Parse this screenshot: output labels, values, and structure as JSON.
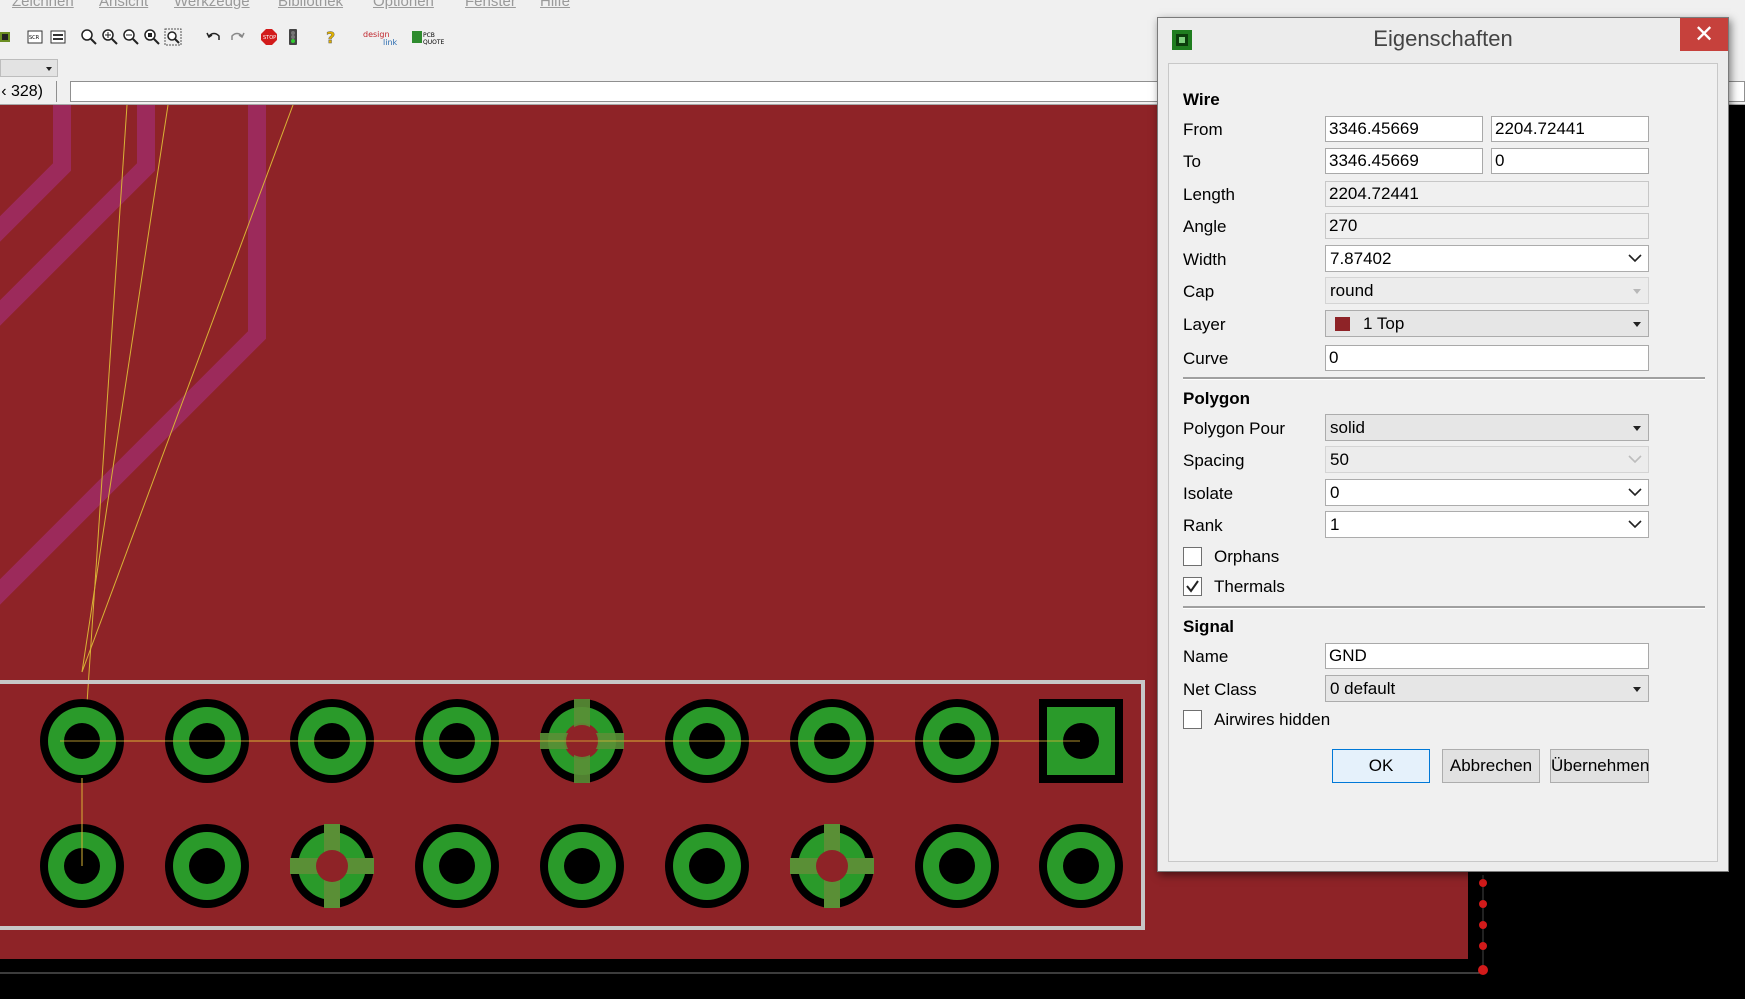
{
  "menubar": {
    "items": [
      "Zeichnen",
      "Ansicht",
      "Werkzeuge",
      "Bibliothek",
      "Optionen",
      "Fenster",
      "Hilfe"
    ]
  },
  "toolbar": {
    "icons": [
      "board-icon",
      "script-icon",
      "script2-icon",
      "zoom-fit-icon",
      "zoom-in-icon",
      "zoom-out-icon",
      "zoom-select-icon",
      "zoom-window-icon",
      "undo-icon",
      "redo-icon",
      "stop-icon",
      "go-icon",
      "help-icon",
      "design-link-icon",
      "pcb-quote-icon"
    ]
  },
  "command_line": {
    "coordinates": "328)",
    "coordinates_prefix": "‹",
    "value": ""
  },
  "colors": {
    "board_copper_top": "#8e2327",
    "pad_green": "#2a9a2a",
    "dimension_outline": "#c7c7c7",
    "airwire": "#d9b236",
    "dialog_close": "#c6413c",
    "layer_swatch": "#8e2327"
  },
  "dialog": {
    "title": "Eigenschaften",
    "close_glyph": "✕",
    "wire": {
      "heading": "Wire",
      "from_label": "From",
      "from_x": "3346.45669",
      "from_y": "2204.72441",
      "to_label": "To",
      "to_x": "3346.45669",
      "to_y": "0",
      "length_label": "Length",
      "length": "2204.72441",
      "angle_label": "Angle",
      "angle": "270",
      "width_label": "Width",
      "width": "7.87402",
      "cap_label": "Cap",
      "cap": "round",
      "layer_label": "Layer",
      "layer": "1 Top",
      "curve_label": "Curve",
      "curve": "0"
    },
    "polygon": {
      "heading": "Polygon",
      "pour_label": "Polygon Pour",
      "pour": "solid",
      "spacing_label": "Spacing",
      "spacing": "50",
      "isolate_label": "Isolate",
      "isolate": "0",
      "rank_label": "Rank",
      "rank": "1",
      "orphans_label": "Orphans",
      "orphans_checked": false,
      "thermals_label": "Thermals",
      "thermals_checked": true
    },
    "signal": {
      "heading": "Signal",
      "name_label": "Name",
      "name": "GND",
      "netclass_label": "Net Class",
      "netclass": "0 default",
      "airwires_hidden_label": "Airwires hidden",
      "airwires_hidden_checked": false
    },
    "buttons": {
      "ok": "OK",
      "cancel": "Abbrechen",
      "apply": "Übernehmen"
    }
  }
}
